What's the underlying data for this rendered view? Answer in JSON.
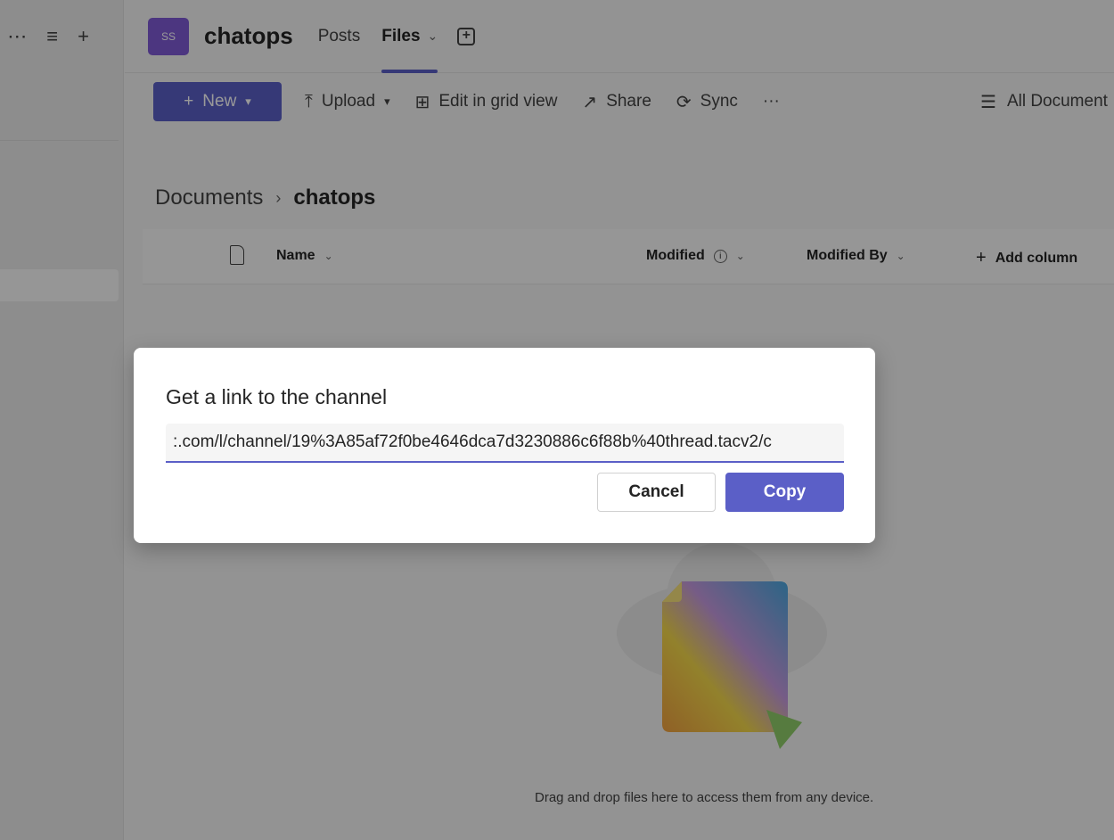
{
  "left_pane": {
    "more_icon": "⋯",
    "filter_icon": "≡",
    "add_icon": "+"
  },
  "header": {
    "team_initials": "SS",
    "team_name": "chatops",
    "tabs": [
      {
        "label": "Posts"
      },
      {
        "label": "Files",
        "chevron": "⌄"
      }
    ],
    "add_tab_icon": "+"
  },
  "toolbar": {
    "new_label": "New",
    "upload_label": "Upload",
    "edit_grid_label": "Edit in grid view",
    "share_label": "Share",
    "sync_label": "Sync",
    "more_label": "···",
    "view_label": "All Document"
  },
  "breadcrumb": {
    "root": "Documents",
    "separator": "›",
    "current": "chatops"
  },
  "columns": {
    "name": "Name",
    "modified": "Modified",
    "modified_by": "Modified By",
    "add_column": "Add column"
  },
  "empty_state": {
    "text": "Drag and drop files here to access them from any device."
  },
  "dialog": {
    "title": "Get a link to the channel",
    "link_value": ":.com/l/channel/19%3A85af72f0be4646dca7d3230886c6f88b%40thread.tacv2/c",
    "cancel_label": "Cancel",
    "copy_label": "Copy"
  },
  "colors": {
    "accent": "#5b5fc7",
    "avatar": "#7f5bd6"
  }
}
